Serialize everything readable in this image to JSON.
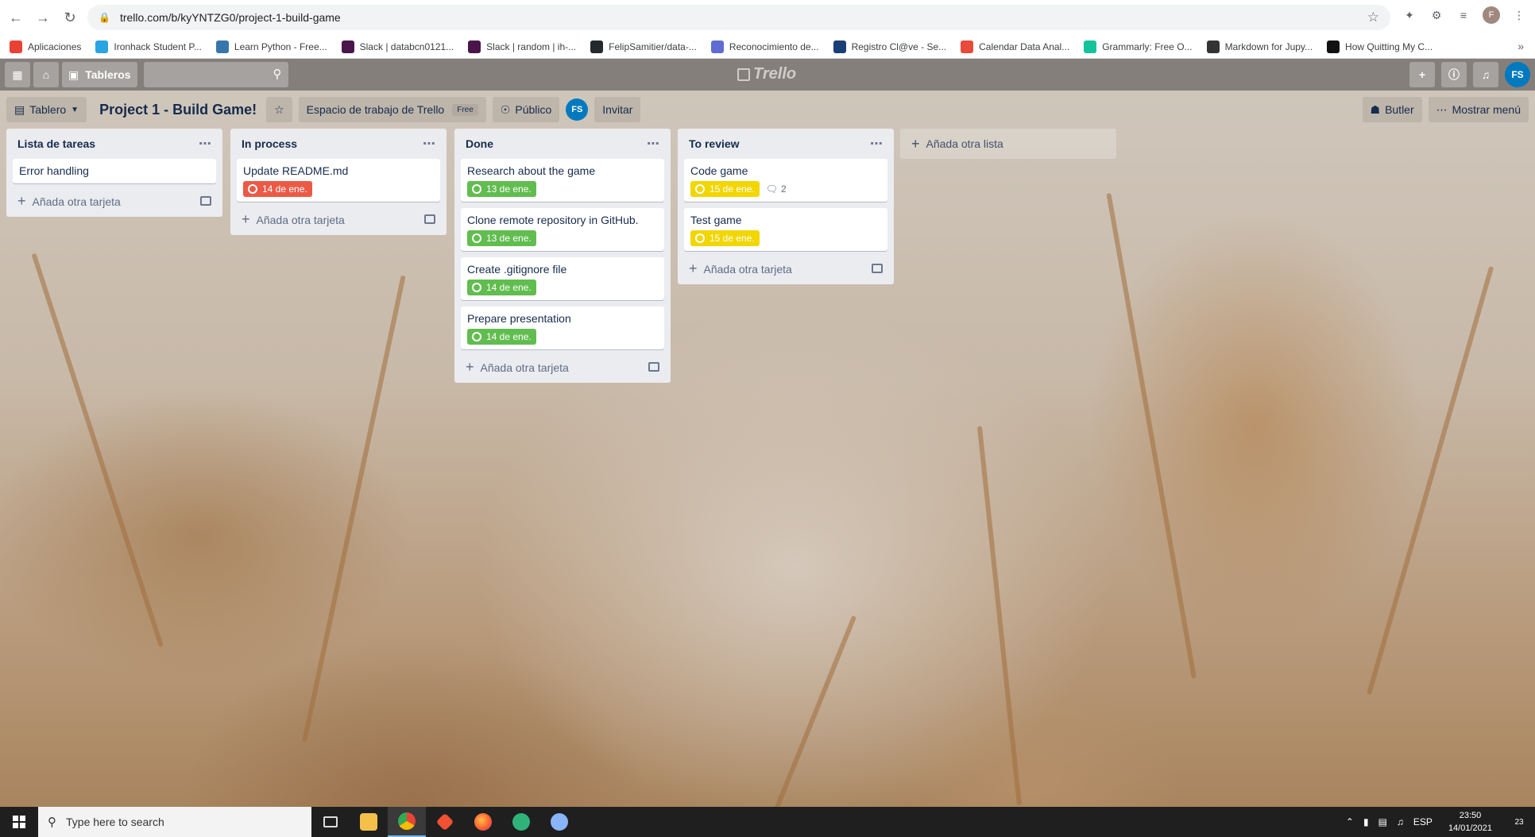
{
  "browser": {
    "url": "trello.com/b/kyYNTZG0/project-1-build-game",
    "bookmarks": [
      {
        "label": "Aplicaciones",
        "color": "#e94235"
      },
      {
        "label": "Ironhack Student P...",
        "color": "#2aa4e3"
      },
      {
        "label": "Learn Python - Free...",
        "color": "#3776ab"
      },
      {
        "label": "Slack | databcn0121...",
        "color": "#4a154b"
      },
      {
        "label": "Slack | random | ih-...",
        "color": "#4a154b"
      },
      {
        "label": "FelipSamitier/data-...",
        "color": "#24292e"
      },
      {
        "label": "Reconocimiento de...",
        "color": "#5f6cd4"
      },
      {
        "label": "Registro Cl@ve - Se...",
        "color": "#1a3e78"
      },
      {
        "label": "Calendar Data Anal...",
        "color": "#e84a3b"
      },
      {
        "label": "Grammarly: Free O...",
        "color": "#15c39a"
      },
      {
        "label": "Markdown for Jupy...",
        "color": "#333333"
      },
      {
        "label": "How Quitting My C...",
        "color": "#111111"
      }
    ],
    "profile_initial": "F"
  },
  "header": {
    "boards_label": "Tableros",
    "logo": "Trello",
    "avatar": "FS"
  },
  "board": {
    "view_label": "Tablero",
    "title": "Project 1 - Build Game!",
    "workspace": "Espacio de trabajo de Trello",
    "workspace_tag": "Free",
    "visibility": "Público",
    "member": "FS",
    "invite": "Invitar",
    "butler": "Butler",
    "menu": "Mostrar menú"
  },
  "lists": [
    {
      "title": "Lista de tareas",
      "cards": [
        {
          "title": "Error handling"
        }
      ],
      "add_label": "Añada otra tarjeta"
    },
    {
      "title": "In process",
      "cards": [
        {
          "title": "Update README.md",
          "due": "14 de ene.",
          "due_status": "red"
        }
      ],
      "add_label": "Añada otra tarjeta"
    },
    {
      "title": "Done",
      "cards": [
        {
          "title": "Research about the game",
          "due": "13 de ene.",
          "due_status": "green"
        },
        {
          "title": "Clone remote repository in GitHub.",
          "due": "13 de ene.",
          "due_status": "green"
        },
        {
          "title": "Create .gitignore file",
          "due": "14 de ene.",
          "due_status": "green"
        },
        {
          "title": "Prepare presentation",
          "due": "14 de ene.",
          "due_status": "green"
        }
      ],
      "add_label": "Añada otra tarjeta"
    },
    {
      "title": "To review",
      "cards": [
        {
          "title": "Code game",
          "due": "15 de ene.",
          "due_status": "yellow",
          "comments": "2"
        },
        {
          "title": "Test game",
          "due": "15 de ene.",
          "due_status": "yellow"
        }
      ],
      "add_label": "Añada otra tarjeta"
    }
  ],
  "add_list_label": "Añada otra lista",
  "taskbar": {
    "search_placeholder": "Type here to search",
    "language": "ESP",
    "time": "23:50",
    "date": "14/01/2021",
    "notifications": "23"
  }
}
